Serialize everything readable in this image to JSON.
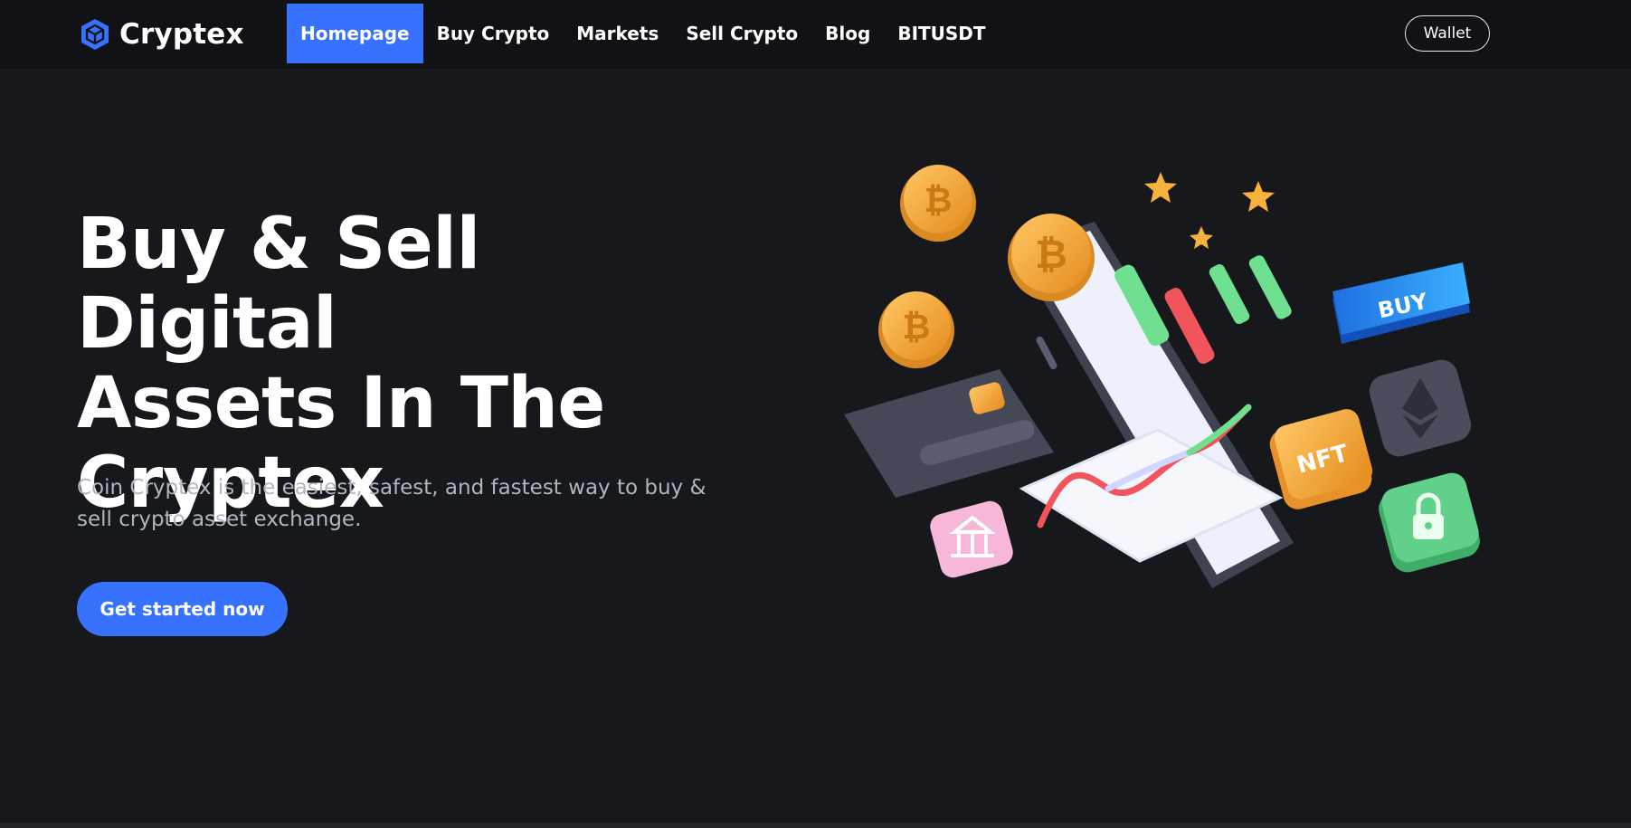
{
  "header": {
    "brand_name": "Cryptex",
    "brand_icon": "cube-logo-icon",
    "nav": [
      {
        "label": "Homepage",
        "active": true
      },
      {
        "label": "Buy Crypto",
        "active": false
      },
      {
        "label": "Markets",
        "active": false
      },
      {
        "label": "Sell Crypto",
        "active": false
      },
      {
        "label": "Blog",
        "active": false
      },
      {
        "label": "BITUSDT",
        "active": false
      }
    ],
    "wallet_label": "Wallet"
  },
  "hero": {
    "title_lines": [
      "Buy & Sell Digital",
      "Assets In The",
      "Cryptex"
    ],
    "subtitle": "Coin Cryptex is the easiest, safest, and fastest way to buy & sell crypto asset exchange.",
    "cta_label": "Get started now"
  },
  "illustration": {
    "buy_tile_label": "BUY",
    "nft_tile_label": "NFT",
    "coin_symbol": "₿"
  },
  "colors": {
    "accent": "#3772ff",
    "background": "#17181c",
    "header_background": "#111215",
    "subtitle_text": "#b1b5c3",
    "coin_gold": "#f4a93a",
    "candle_green": "#6fe08f",
    "candle_red": "#f2545b"
  }
}
